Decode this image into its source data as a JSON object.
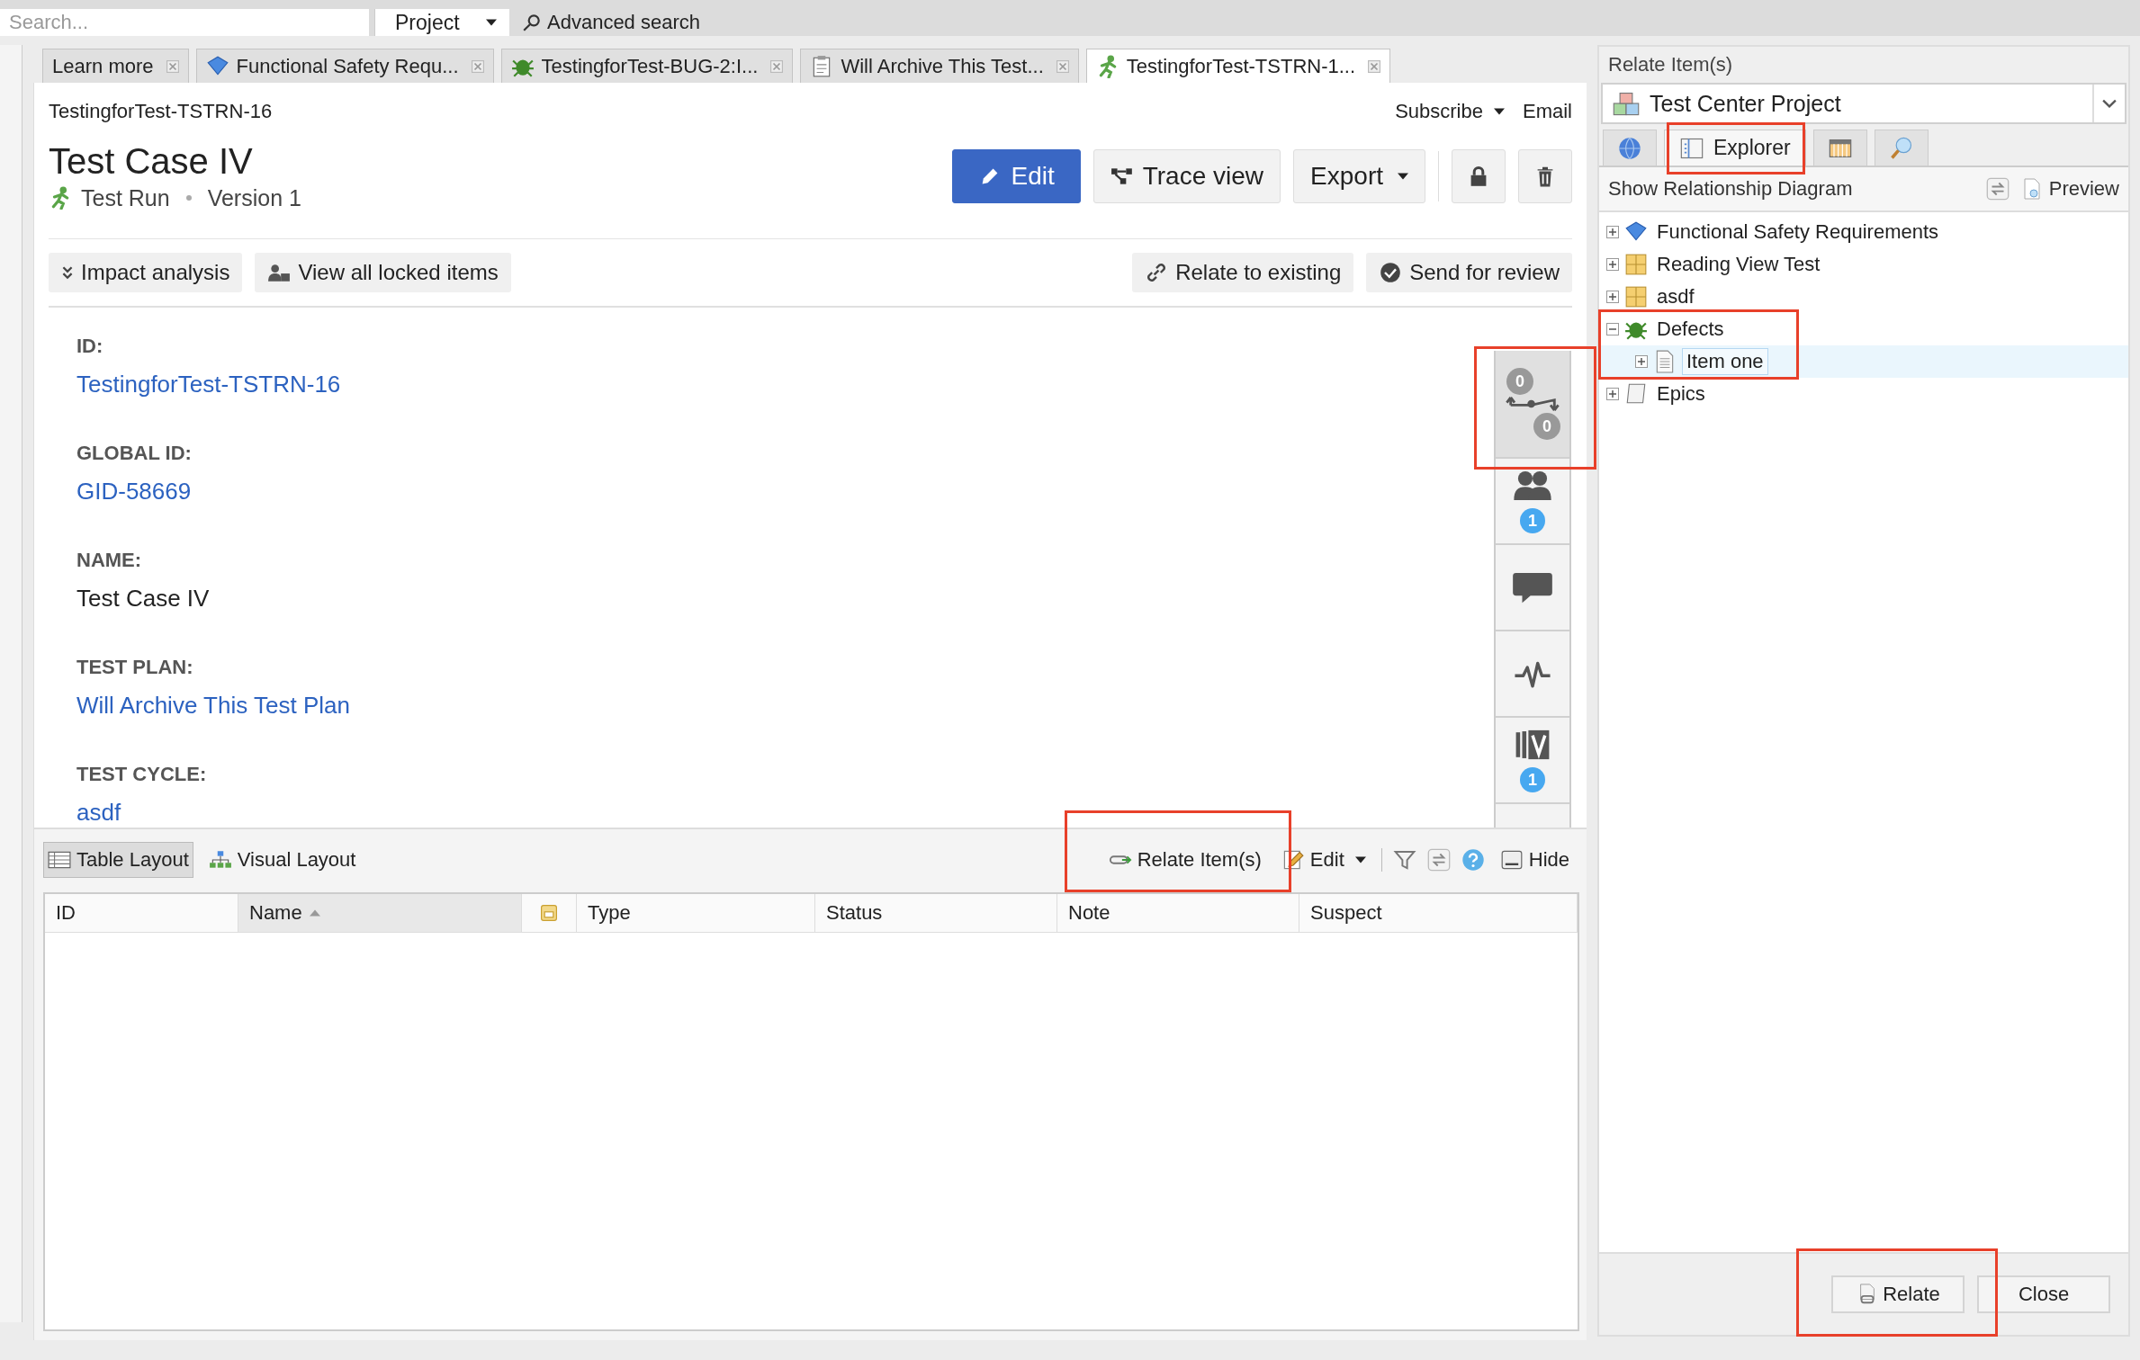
{
  "top_bar": {
    "search": {
      "placeholder": "Search..."
    },
    "scope": "Project",
    "advanced_search": "Advanced search"
  },
  "tabs": [
    {
      "label": "Learn more",
      "kind": "none",
      "selected": false
    },
    {
      "label": "Functional Safety Requ...",
      "kind": "requirement",
      "selected": false
    },
    {
      "label": "TestingforTest-BUG-2:I...",
      "kind": "defect",
      "selected": false
    },
    {
      "label": "Will Archive This Test...",
      "kind": "plan",
      "selected": false
    },
    {
      "label": "TestingforTest-TSTRN-1...",
      "kind": "run",
      "selected": true
    }
  ],
  "item": {
    "breadcrumb": "TestingforTest-TSTRN-16",
    "subscribe": "Subscribe",
    "email": "Email",
    "title": "Test Case IV",
    "type": "Test Run",
    "version": "Version 1",
    "actions": [
      "Edit",
      "Trace view",
      "Export"
    ],
    "toolbar_left": [
      "Impact analysis",
      "View all locked items"
    ],
    "toolbar_right": [
      "Relate to existing",
      "Send for review"
    ]
  },
  "fields": [
    {
      "label": "ID:",
      "value": "TestingforTest-TSTRN-16",
      "link": true
    },
    {
      "label": "GLOBAL ID:",
      "value": "GID-58669",
      "link": true
    },
    {
      "label": "NAME:",
      "value": "Test Case IV",
      "link": false
    },
    {
      "label": "TEST PLAN:",
      "value": "Will Archive This Test Plan",
      "link": true
    },
    {
      "label": "TEST CYCLE:",
      "value": "asdf",
      "link": true
    }
  ],
  "side_rail": [
    {
      "kind": "relationships",
      "selected": true,
      "badges": [
        "0",
        "0"
      ]
    },
    {
      "kind": "users",
      "selected": false,
      "badges": [
        "1"
      ]
    },
    {
      "kind": "comments",
      "selected": false
    },
    {
      "kind": "activity",
      "selected": false
    },
    {
      "kind": "versions",
      "selected": false,
      "badges": [
        "1"
      ]
    }
  ],
  "bottom_panel": {
    "layouts": [
      {
        "label": "Table Layout",
        "kind": "table",
        "selected": true
      },
      {
        "label": "Visual Layout",
        "kind": "visual",
        "selected": false
      }
    ],
    "relate": "Relate Item(s)",
    "edit": "Edit",
    "hide": "Hide",
    "columns": [
      {
        "label": "ID",
        "kind": "text",
        "sorted": false
      },
      {
        "label": "Name",
        "kind": "text",
        "sorted": true
      },
      {
        "kind": "icon",
        "sorted": false
      },
      {
        "label": "Type",
        "kind": "text",
        "sorted": false
      },
      {
        "label": "Status",
        "kind": "text",
        "sorted": false
      },
      {
        "label": "Note",
        "kind": "text",
        "sorted": false
      },
      {
        "label": "Suspect",
        "kind": "text",
        "sorted": false
      }
    ]
  },
  "dialog": {
    "title": "Relate Item(s)",
    "project": "Test Center Project",
    "tabs": [
      {
        "kind": "globe",
        "selected": false
      },
      {
        "kind": "explorer",
        "label": "Explorer",
        "selected": true
      },
      {
        "kind": "calendar",
        "selected": false
      },
      {
        "kind": "search",
        "selected": false
      }
    ],
    "show_diagram": "Show Relationship Diagram",
    "preview": "Preview",
    "tree": [
      {
        "label": "Functional Safety Requirements",
        "kind": "requirement",
        "expanded": false,
        "selected": false
      },
      {
        "label": "Reading View Test",
        "kind": "folder",
        "expanded": false,
        "selected": false
      },
      {
        "label": "asdf",
        "kind": "folder",
        "expanded": false,
        "selected": false
      },
      {
        "label": "Defects",
        "kind": "defect",
        "expanded": true,
        "selected": false,
        "children": [
          {
            "label": "Item one",
            "kind": "document",
            "expanded": false,
            "selected": true
          }
        ]
      },
      {
        "label": "Epics",
        "kind": "epic",
        "expanded": false,
        "selected": false
      }
    ],
    "buttons": [
      "Relate",
      "Close"
    ]
  }
}
